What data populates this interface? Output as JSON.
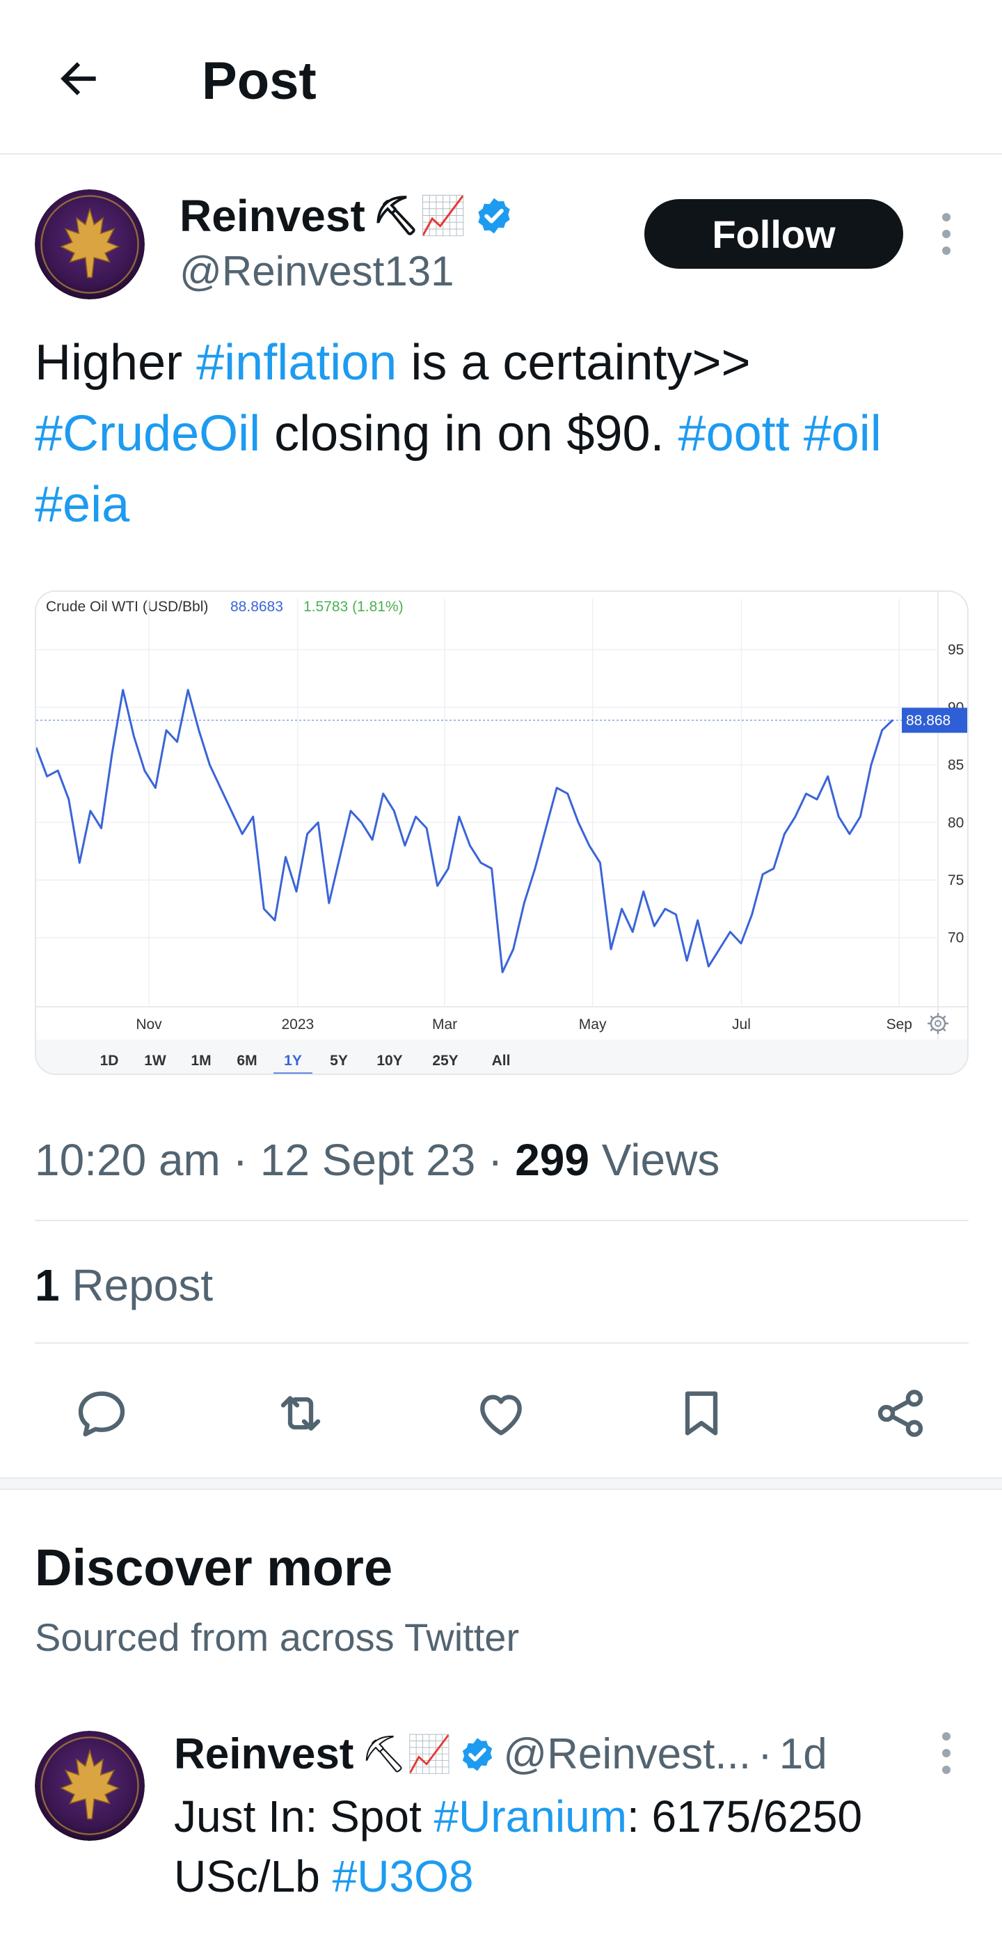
{
  "header": {
    "title": "Post"
  },
  "post": {
    "author_name": "Reinvest",
    "author_emoji": "⛏📈",
    "handle": "@Reinvest131",
    "follow_label": "Follow",
    "text_parts": [
      {
        "t": "Higher ",
        "tag": false
      },
      {
        "t": "#inflation",
        "tag": true
      },
      {
        "t": " is a certainty>> ",
        "tag": false
      },
      {
        "t": "#CrudeOil",
        "tag": true
      },
      {
        "t": " closing in on $90. ",
        "tag": false
      },
      {
        "t": "#oott",
        "tag": true
      },
      {
        "t": " ",
        "tag": false
      },
      {
        "t": "#oil",
        "tag": true
      },
      {
        "t": " ",
        "tag": false
      },
      {
        "t": "#eia",
        "tag": true
      }
    ],
    "time": "10:20 am",
    "date": "12 Sept 23",
    "views_count": "299",
    "views_label": "Views",
    "reposts_count": "1",
    "reposts_label": "Repost"
  },
  "chart_data": {
    "type": "line",
    "title": "Crude Oil WTI (USD/Bbl)",
    "last_value": "88.8683",
    "change": "1.5783 (1.81%)",
    "price_tag": "88.868",
    "x_tick_labels": [
      "Nov",
      "2023",
      "Mar",
      "May",
      "Jul",
      "Sep"
    ],
    "y_tick_labels": [
      "95",
      "90",
      "85",
      "80",
      "75",
      "70"
    ],
    "ylim": [
      64,
      97
    ],
    "grid": true,
    "range_buttons": [
      "1D",
      "1W",
      "1M",
      "6M",
      "1Y",
      "5Y",
      "10Y",
      "25Y",
      "All"
    ],
    "selected_range": "1Y",
    "line_color": "#3a64d8",
    "series": [
      {
        "values": [
          86.5,
          84,
          84.5,
          82,
          76.5,
          81,
          79.5,
          86,
          91.5,
          87.5,
          84.5,
          83,
          88,
          87,
          91.5,
          88,
          85,
          83,
          81,
          79,
          80.5,
          72.5,
          71.5,
          77,
          74,
          79,
          80,
          73,
          77,
          81,
          80,
          78.5,
          82.5,
          81,
          78,
          80.5,
          79.5,
          74.5,
          76,
          80.5,
          78,
          76.5,
          76,
          67,
          69,
          73,
          76,
          79.5,
          83,
          82.5,
          80,
          78,
          76.5,
          69,
          72.5,
          70.5,
          74,
          71,
          72.5,
          72,
          68,
          71.5,
          67.5,
          69,
          70.5,
          69.5,
          72,
          75.5,
          76,
          79,
          80.5,
          82.5,
          82,
          84,
          80.5,
          79,
          80.5,
          85,
          88,
          88.9
        ]
      }
    ]
  },
  "actions": [
    {
      "name": "reply-icon"
    },
    {
      "name": "repost-icon"
    },
    {
      "name": "like-icon"
    },
    {
      "name": "bookmark-icon"
    },
    {
      "name": "share-icon"
    }
  ],
  "discover": {
    "title": "Discover more",
    "subtitle": "Sourced from across Twitter",
    "item": {
      "author_name": "Reinvest",
      "author_emoji": "⛏📈",
      "handle": "@Reinvest...",
      "time_sep": "·",
      "time": "1d",
      "text_parts": [
        {
          "t": "Just In: Spot ",
          "tag": false
        },
        {
          "t": "#Uranium",
          "tag": true
        },
        {
          "t": ": 6175/6250 USc/Lb ",
          "tag": false
        },
        {
          "t": "#U3O8",
          "tag": true
        }
      ]
    }
  },
  "colors": {
    "accent": "#1d9bf0",
    "text": "#0f1419",
    "muted": "#536471",
    "follow_bg": "#0f1419"
  }
}
